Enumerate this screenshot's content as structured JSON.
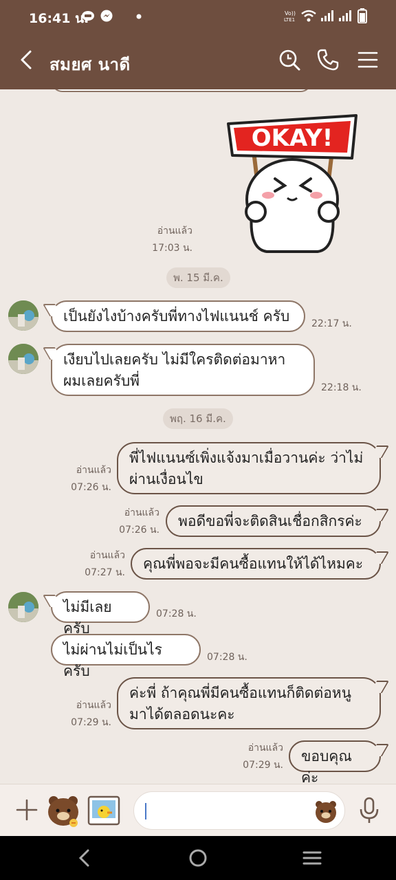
{
  "status_bar": {
    "time": "16:41 น.",
    "volte": "Vo))\nLTE1"
  },
  "header": {
    "contact_name": "สมยศ นาดี"
  },
  "chat": {
    "sticker": {
      "text": "OKAY!"
    },
    "sticker_meta": {
      "read": "อ่านแล้ว",
      "time": "17:03 น."
    },
    "date_1": "พ. 15 มี.ค.",
    "date_2": "พฤ. 16 มี.ค.",
    "messages": [
      {
        "side": "incoming",
        "text": "เป็นยังไงบ้างครับพี่ทางไฟแนนช์ ครับ",
        "time": "22:17 น."
      },
      {
        "side": "incoming",
        "text": "เงียบไปเลยครับ ไม่มีใครติดต่อมาหาผมเลยครับพี่",
        "line1": "เงียบไปเลยครับ ไม่มีใครติดต่อมาหา",
        "line2": "ผมเลยครับพี่",
        "time": "22:18 น."
      },
      {
        "side": "outgoing",
        "line1": "พี่ไฟแนนซ์เพิ่งแจ้งมาเมื่อวานค่ะ ว่าไม่",
        "line2": "ผ่านเงื่อนไข",
        "read": "อ่านแล้ว",
        "time": "07:26 น."
      },
      {
        "side": "outgoing",
        "text": "พอดีขอพี่จะติดสินเชื่อกสิกรค่ะ",
        "read": "อ่านแล้ว",
        "time": "07:26 น."
      },
      {
        "side": "outgoing",
        "text": "คุณพี่พอจะมีคนซื้อแทนให้ได้ไหมคะ",
        "read": "อ่านแล้ว",
        "time": "07:27 น."
      },
      {
        "side": "incoming",
        "text": "ไม่มีเลยครับ",
        "time": "07:28 น."
      },
      {
        "side": "incoming",
        "text": "ไม่ผ่านไม่เป็นไรครับ",
        "time": "07:28 น."
      },
      {
        "side": "outgoing",
        "line1": "ค่ะพี่ ถ้าคุณพี่มีคนซื้อแทนก็ติดต่อหนู",
        "line2": "มาได้ตลอดนะคะ",
        "read": "อ่านแล้ว",
        "time": "07:29 น."
      },
      {
        "side": "outgoing",
        "text": "ขอบคุณค่ะ",
        "read": "อ่านแล้ว",
        "time": "07:29 น."
      }
    ]
  },
  "composer": {
    "input_value": ""
  },
  "colors": {
    "header_bg": "#6e4e3f",
    "chat_bg": "#efe9e4",
    "bubble_border": "#8e7667"
  },
  "icons": [
    "back-icon",
    "search-icon",
    "phone-icon",
    "menu-icon",
    "plus-icon",
    "sticker-icon",
    "photo-icon",
    "emoji-icon",
    "mic-icon"
  ]
}
